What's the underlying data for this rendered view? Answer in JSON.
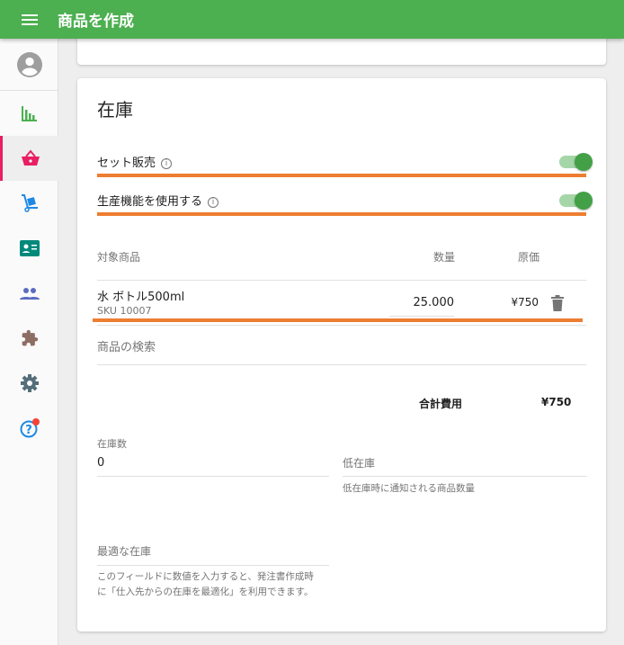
{
  "header": {
    "title": "商品を作成"
  },
  "sidebar": {
    "items": [
      "avatar",
      "analytics",
      "shop",
      "delivery",
      "contacts",
      "people",
      "extensions",
      "settings",
      "help"
    ],
    "active": "shop",
    "accent": "#e91e63"
  },
  "inventory": {
    "title": "在庫",
    "set_sale": {
      "label": "セット販売",
      "on": true
    },
    "production": {
      "label": "生産機能を使用する",
      "on": true
    },
    "table": {
      "headers": {
        "product": "対象商品",
        "quantity": "数量",
        "cost": "原価"
      },
      "rows": [
        {
          "name": "水 ボトル500ml",
          "sku": "SKU 10007",
          "quantity": "25.000",
          "cost": "¥750"
        }
      ],
      "search_placeholder": "商品の検索"
    },
    "total": {
      "label": "合計費用",
      "value": "¥750"
    },
    "stock": {
      "label": "在庫数",
      "value": "0"
    },
    "low_stock": {
      "label": "低在庫",
      "helper": "低在庫時に通知される商品数量"
    },
    "optimal": {
      "label": "最適な在庫",
      "helper1": "このフィールドに数値を入力すると、発注書作成時",
      "helper2": "に「仕入先からの在庫を最適化」を利用できます。"
    }
  },
  "colors": {
    "primary": "#4caf50",
    "highlight": "#ed7d31"
  }
}
